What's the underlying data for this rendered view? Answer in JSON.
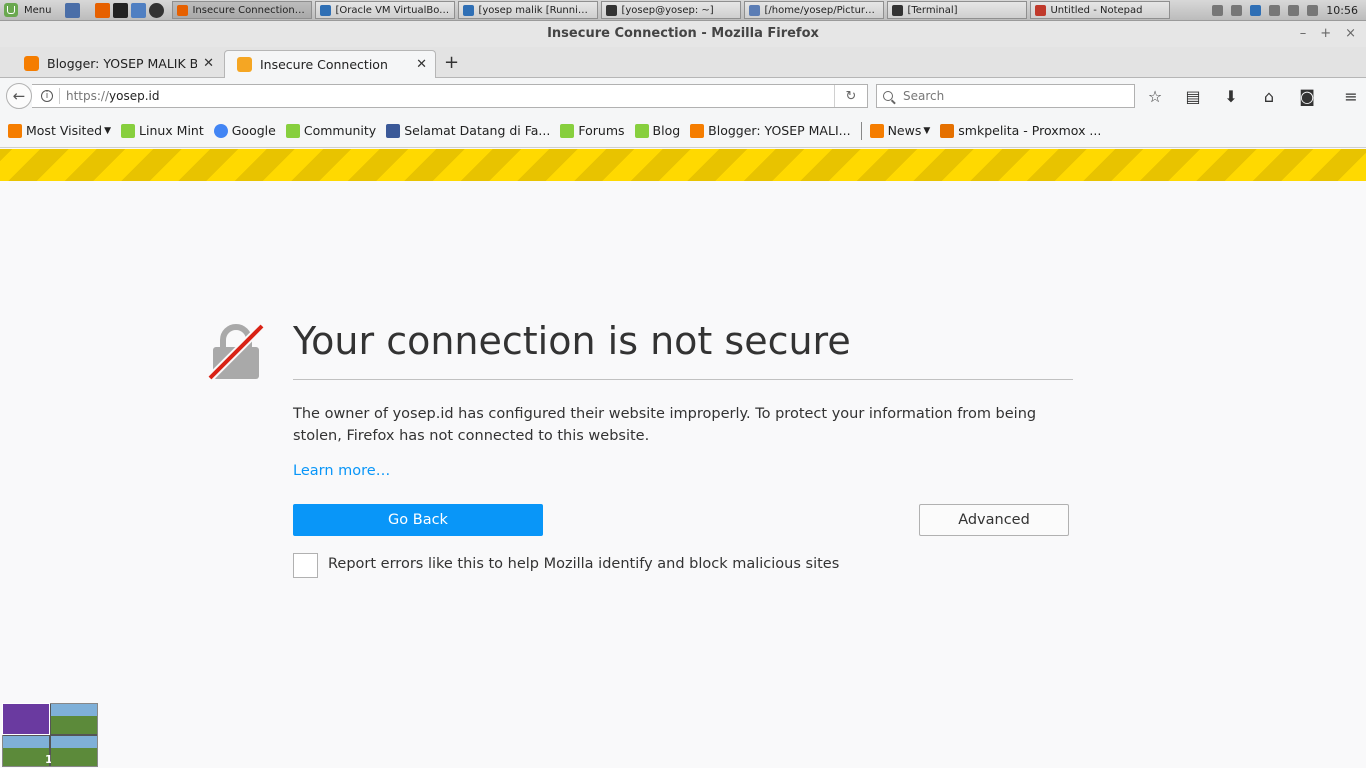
{
  "taskbar": {
    "menu_label": "Menu",
    "tasks": [
      {
        "label": "Insecure Connection - ...",
        "color": "#e66000"
      },
      {
        "label": "[Oracle VM VirtualBox ...",
        "color": "#2f6fb5"
      },
      {
        "label": "[yosep malik [Running...",
        "color": "#2f6fb5"
      },
      {
        "label": "[yosep@yosep: ~]",
        "color": "#333333"
      },
      {
        "label": "[/home/yosep/Pictures/...",
        "color": "#5b7db5"
      },
      {
        "label": "[Terminal]",
        "color": "#333333"
      },
      {
        "label": "Untitled - Notepad",
        "color": "#c0392b"
      }
    ],
    "clock": "10:56"
  },
  "window": {
    "title": "Insecure Connection - Mozilla Firefox"
  },
  "tabs": [
    {
      "label": "Blogger: YOSEP MALIK B...",
      "icon": "blogger-icon",
      "color": "#f57d00"
    },
    {
      "label": "Insecure Connection",
      "icon": "warning-icon",
      "color": "#f5a623"
    }
  ],
  "navbar": {
    "url_scheme": "https://",
    "url_host": "yosep.id",
    "search_placeholder": "Search"
  },
  "bookmarks": [
    {
      "label": "Most Visited",
      "icon": "rss-icon",
      "color": "#f57d00",
      "dropdown": true
    },
    {
      "label": "Linux Mint",
      "icon": "mint-icon",
      "color": "#87cf3e"
    },
    {
      "label": "Google",
      "icon": "google-icon",
      "color": "#4285f4"
    },
    {
      "label": "Community",
      "icon": "mint-icon",
      "color": "#87cf3e"
    },
    {
      "label": "Selamat Datang di Fa...",
      "icon": "facebook-icon",
      "color": "#3b5998"
    },
    {
      "label": "Forums",
      "icon": "mint-icon",
      "color": "#87cf3e"
    },
    {
      "label": "Blog",
      "icon": "mint-icon",
      "color": "#87cf3e"
    },
    {
      "label": "Blogger: YOSEP MALI...",
      "icon": "blogger-icon",
      "color": "#f57d00"
    },
    {
      "label": "News",
      "icon": "rss-icon",
      "color": "#f57d00",
      "dropdown": true
    },
    {
      "label": "smkpelita - Proxmox ...",
      "icon": "proxmox-icon",
      "color": "#e57000"
    }
  ],
  "error_page": {
    "title": "Your connection is not secure",
    "description": "The owner of yosep.id has configured their website improperly. To protect your information from being stolen, Firefox has not connected to this website.",
    "learn_more": "Learn more…",
    "go_back": "Go Back",
    "advanced": "Advanced",
    "report_label": "Report errors like this to help Mozilla identify and block malicious sites",
    "accent_color": "#0996f8",
    "stripe_color": "#ffd900"
  },
  "pager": {
    "active_workspace": "1"
  }
}
